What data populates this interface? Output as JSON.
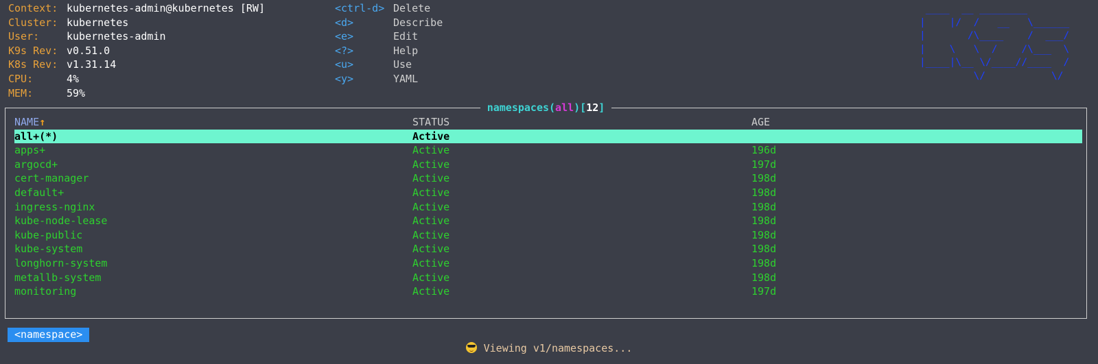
{
  "header": {
    "info": [
      {
        "label": "Context:",
        "value": "kubernetes-admin@kubernetes [RW]"
      },
      {
        "label": "Cluster:",
        "value": "kubernetes"
      },
      {
        "label": "User:",
        "value": "kubernetes-admin"
      },
      {
        "label": "K9s Rev:",
        "value": "v0.51.0"
      },
      {
        "label": "K8s Rev:",
        "value": "v1.31.14"
      },
      {
        "label": "CPU:",
        "value": "4%"
      },
      {
        "label": "MEM:",
        "value": "59%"
      }
    ],
    "keys": [
      {
        "key": "<ctrl-d>",
        "desc": "Delete"
      },
      {
        "key": "<d>",
        "desc": "Describe"
      },
      {
        "key": "<e>",
        "desc": "Edit"
      },
      {
        "key": "<?>",
        "desc": "Help"
      },
      {
        "key": "<u>",
        "desc": "Use"
      },
      {
        "key": "<y>",
        "desc": "YAML"
      }
    ],
    "logo_art": " ____  __ ________\n|    |/  /   __   \\______\n|       /\\____    /  ___/\n|    \\   \\  /    /\\___  \\\n|____|\\__ \\/____//____  /\n         \\/           \\/",
    "logo_color": "#1e3fff"
  },
  "table": {
    "title": {
      "resource": "namespaces",
      "filter": "all",
      "count": "12"
    },
    "columns": {
      "name": "NAME",
      "sort_indicator": "↑",
      "status": "STATUS",
      "age": "AGE"
    },
    "rows": [
      {
        "name": "all+(*)",
        "status": "Active",
        "age": "",
        "selected": true
      },
      {
        "name": "apps+",
        "status": "Active",
        "age": "196d"
      },
      {
        "name": "argocd+",
        "status": "Active",
        "age": "197d"
      },
      {
        "name": "cert-manager",
        "status": "Active",
        "age": "198d"
      },
      {
        "name": "default+",
        "status": "Active",
        "age": "198d"
      },
      {
        "name": "ingress-nginx",
        "status": "Active",
        "age": "198d"
      },
      {
        "name": "kube-node-lease",
        "status": "Active",
        "age": "198d"
      },
      {
        "name": "kube-public",
        "status": "Active",
        "age": "198d"
      },
      {
        "name": "kube-system",
        "status": "Active",
        "age": "198d"
      },
      {
        "name": "longhorn-system",
        "status": "Active",
        "age": "198d"
      },
      {
        "name": "metallb-system",
        "status": "Active",
        "age": "198d"
      },
      {
        "name": "monitoring",
        "status": "Active",
        "age": "197d"
      }
    ]
  },
  "footer": {
    "crumb": "<namespace>",
    "status_icon": "sunglasses-emoji-icon",
    "status_text": "Viewing v1/namespaces..."
  },
  "colors": {
    "background": "#3b3e48",
    "label": "#e8a13a",
    "key": "#4aa8f0",
    "row_text": "#2ed12e",
    "selected_row": "#6ef5cf",
    "crumb": "#2b8ef0"
  }
}
